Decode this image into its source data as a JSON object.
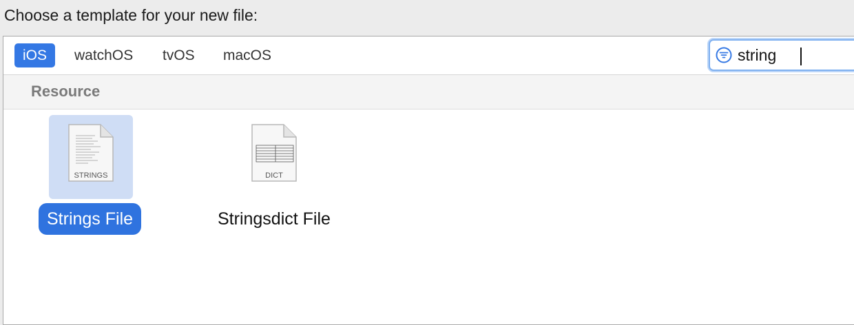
{
  "window": {
    "heading": "Choose a template for your new file:"
  },
  "platform_tabs": [
    {
      "label": "iOS",
      "selected": true
    },
    {
      "label": "watchOS",
      "selected": false
    },
    {
      "label": "tvOS",
      "selected": false
    },
    {
      "label": "macOS",
      "selected": false
    }
  ],
  "search": {
    "value": "string",
    "icon": "filter-icon"
  },
  "section": {
    "title": "Resource"
  },
  "templates": [
    {
      "label": "Strings File",
      "icon_caption": "STRINGS",
      "icon": "strings-document-icon",
      "selected": true
    },
    {
      "label": "Stringsdict File",
      "icon_caption": "DICT",
      "icon": "dict-document-icon",
      "selected": false
    }
  ],
  "colors": {
    "accent": "#3478e4",
    "selection_background": "#cfddf5",
    "section_header_text": "#7a7a7a"
  }
}
